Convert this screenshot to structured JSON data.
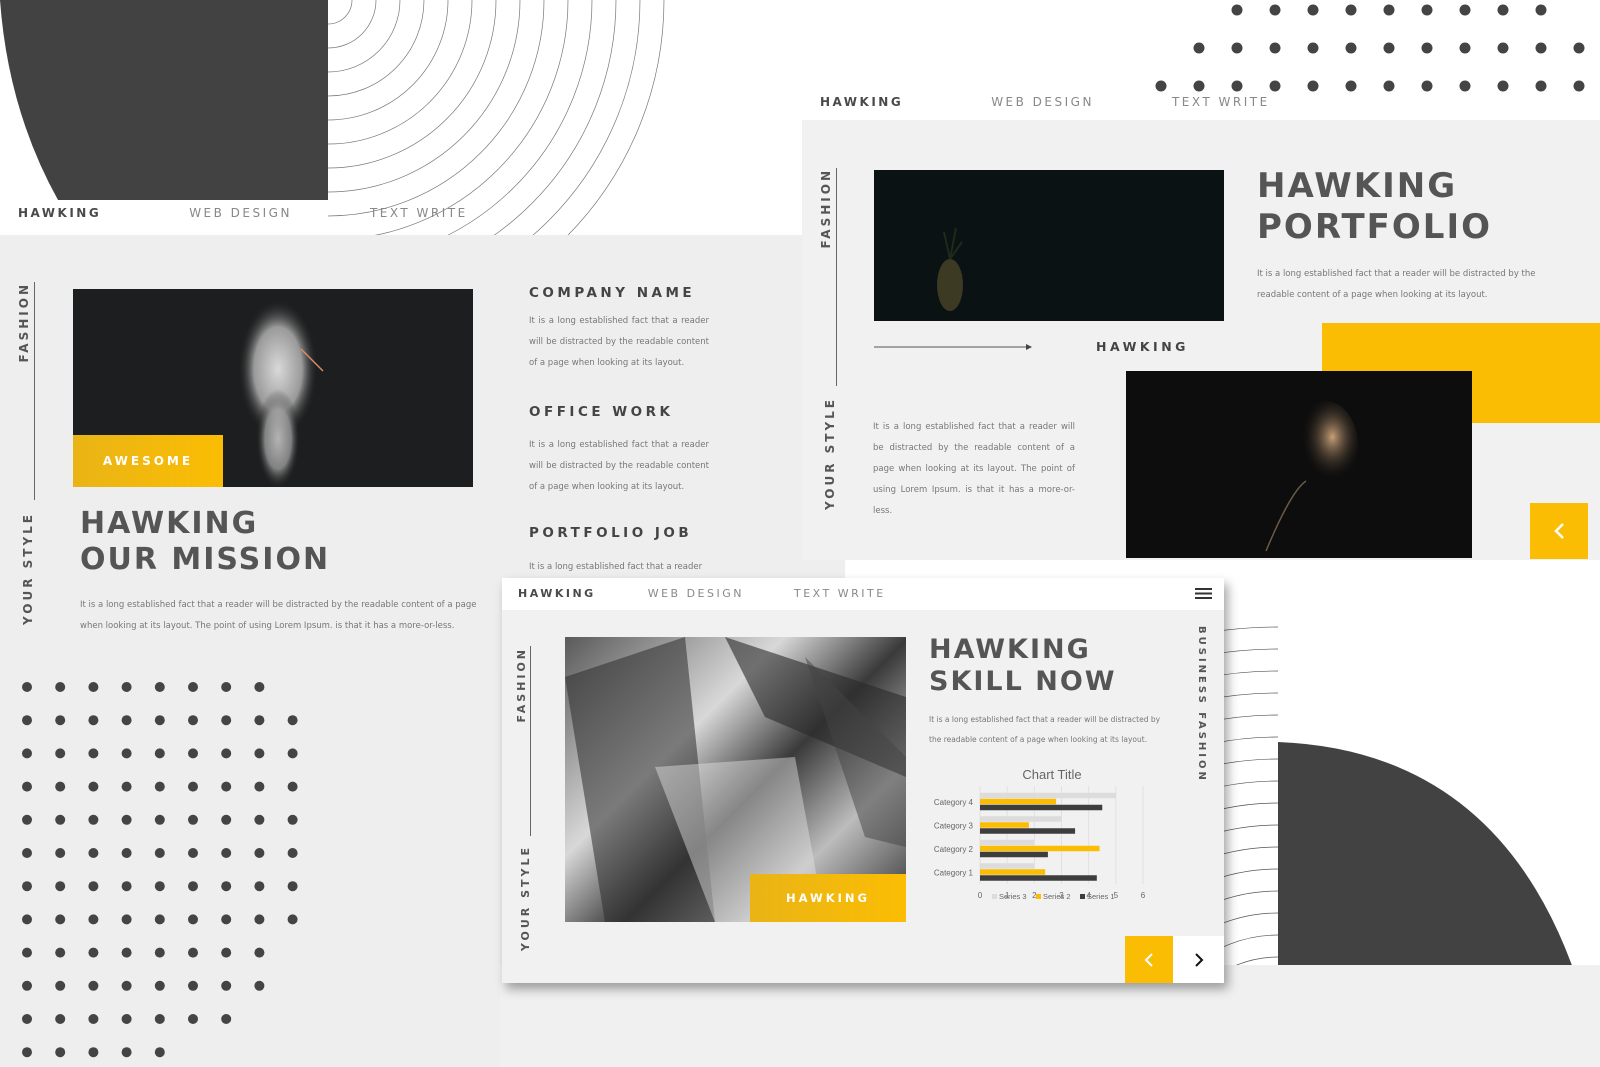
{
  "nav": {
    "brand": "HAWKING",
    "item1": "WEB DESIGN",
    "item2": "TEXT WRITE"
  },
  "vertical": {
    "fashion": "FASHION",
    "your_style": "YOUR STYLE",
    "business_fashion": "BUSINESS FASHION"
  },
  "slide_left": {
    "tag": "AWESOME",
    "title_line1": "HAWKING",
    "title_line2": "OUR MISSION",
    "body": "It is a long established fact that a reader will be distracted by the readable content of a page when looking at its layout. The point of using Lorem Ipsum.  is that it has a more-or-less.",
    "sections": [
      {
        "heading": "COMPANY NAME",
        "text": "It is a long established fact that a reader will be distracted by the readable content of a page when looking at its layout."
      },
      {
        "heading": "OFFICE WORK",
        "text": "It is a long established fact that a reader will be distracted by the readable content of a page when looking at its layout."
      },
      {
        "heading": "PORTFOLIO JOB",
        "text": "It is a long established fact that a reader"
      }
    ]
  },
  "slide_right": {
    "title_line1": "HAWKING",
    "title_line2": "PORTFOLIO",
    "body": "It is a long established fact that a reader will be distracted by the readable content of a page when looking at its layout.",
    "label": "HAWKING",
    "body2": "It is a long established fact that a reader will be distracted by the readable content of a page when looking at its layout. The point of using Lorem Ipsum.  is that it has a more-or-less.",
    "prev_icon": "chevron-left-icon"
  },
  "slide_front": {
    "tag": "HAWKING",
    "title_line1": "HAWKING",
    "title_line2": "SKILL NOW",
    "body": "It is a long established fact that a reader will be distracted by the readable content of a page when looking at its layout.",
    "menu_icon": "hamburger-menu-icon",
    "prev_icon": "chevron-left-icon",
    "next_icon": "chevron-right-icon"
  },
  "colors": {
    "accent": "#fbbc04",
    "dark": "#414141",
    "series3": "#dcdcdc",
    "series2": "#fbbc04",
    "series1": "#3d3d3d"
  },
  "chart_data": {
    "type": "bar",
    "orientation": "horizontal",
    "title": "Chart Title",
    "categories": [
      "Category 1",
      "Category 2",
      "Category 3",
      "Category 4"
    ],
    "series": [
      {
        "name": "Series 3",
        "values": [
          2,
          2,
          3,
          5
        ]
      },
      {
        "name": "Series 2",
        "values": [
          2.4,
          4.4,
          1.8,
          2.8
        ]
      },
      {
        "name": "Series 1",
        "values": [
          4.3,
          2.5,
          3.5,
          4.5
        ]
      }
    ],
    "xlim": [
      0,
      6
    ],
    "xticks": [
      "0",
      "1",
      "2",
      "3",
      "4",
      "5",
      "6"
    ],
    "grid": true,
    "legend": "bottom",
    "xlabel": "",
    "ylabel": ""
  }
}
